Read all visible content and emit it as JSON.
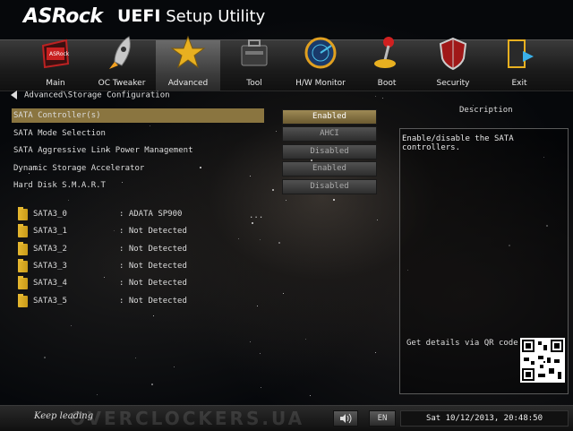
{
  "header": {
    "brand": "ASRock",
    "title_bold": "UEFI",
    "title_rest": " Setup Utility"
  },
  "nav": {
    "tabs": [
      {
        "label": "Main",
        "icon": "main-icon"
      },
      {
        "label": "OC Tweaker",
        "icon": "rocket-icon"
      },
      {
        "label": "Advanced",
        "icon": "star-icon",
        "active": true
      },
      {
        "label": "Tool",
        "icon": "toolbox-icon"
      },
      {
        "label": "H/W Monitor",
        "icon": "radar-icon"
      },
      {
        "label": "Boot",
        "icon": "joystick-icon"
      },
      {
        "label": "Security",
        "icon": "shield-icon"
      },
      {
        "label": "Exit",
        "icon": "exit-door-icon"
      }
    ]
  },
  "breadcrumb": "Advanced\\Storage Configuration",
  "settings": [
    {
      "label": "SATA Controller(s)",
      "value": "Enabled",
      "selected": true
    },
    {
      "label": "SATA Mode Selection",
      "value": "AHCI"
    },
    {
      "label": "SATA Aggressive Link Power Management",
      "value": "Disabled"
    },
    {
      "label": "Dynamic Storage Accelerator",
      "value": "Enabled"
    },
    {
      "label": "Hard Disk S.M.A.R.T",
      "value": "Disabled"
    }
  ],
  "drives": [
    {
      "name": "SATA3_0",
      "value": ": ADATA SP900"
    },
    {
      "name": "SATA3_1",
      "value": ": Not Detected"
    },
    {
      "name": "SATA3_2",
      "value": ": Not Detected"
    },
    {
      "name": "SATA3_3",
      "value": ": Not Detected"
    },
    {
      "name": "SATA3_4",
      "value": ": Not Detected"
    },
    {
      "name": "SATA3_5",
      "value": ": Not Detected"
    }
  ],
  "drive_more": "...",
  "description": {
    "title": "Description",
    "text": "Enable/disable the SATA controllers.",
    "qr_label": "Get details via QR code"
  },
  "footer": {
    "tagline": "Keep leading",
    "watermark": "OVERCLOCKERS.UA",
    "language": "EN",
    "datetime": "Sat 10/12/2013, 20:48:50"
  },
  "colors": {
    "accent_gold": "#8a7540",
    "folder": "#e6b830"
  }
}
